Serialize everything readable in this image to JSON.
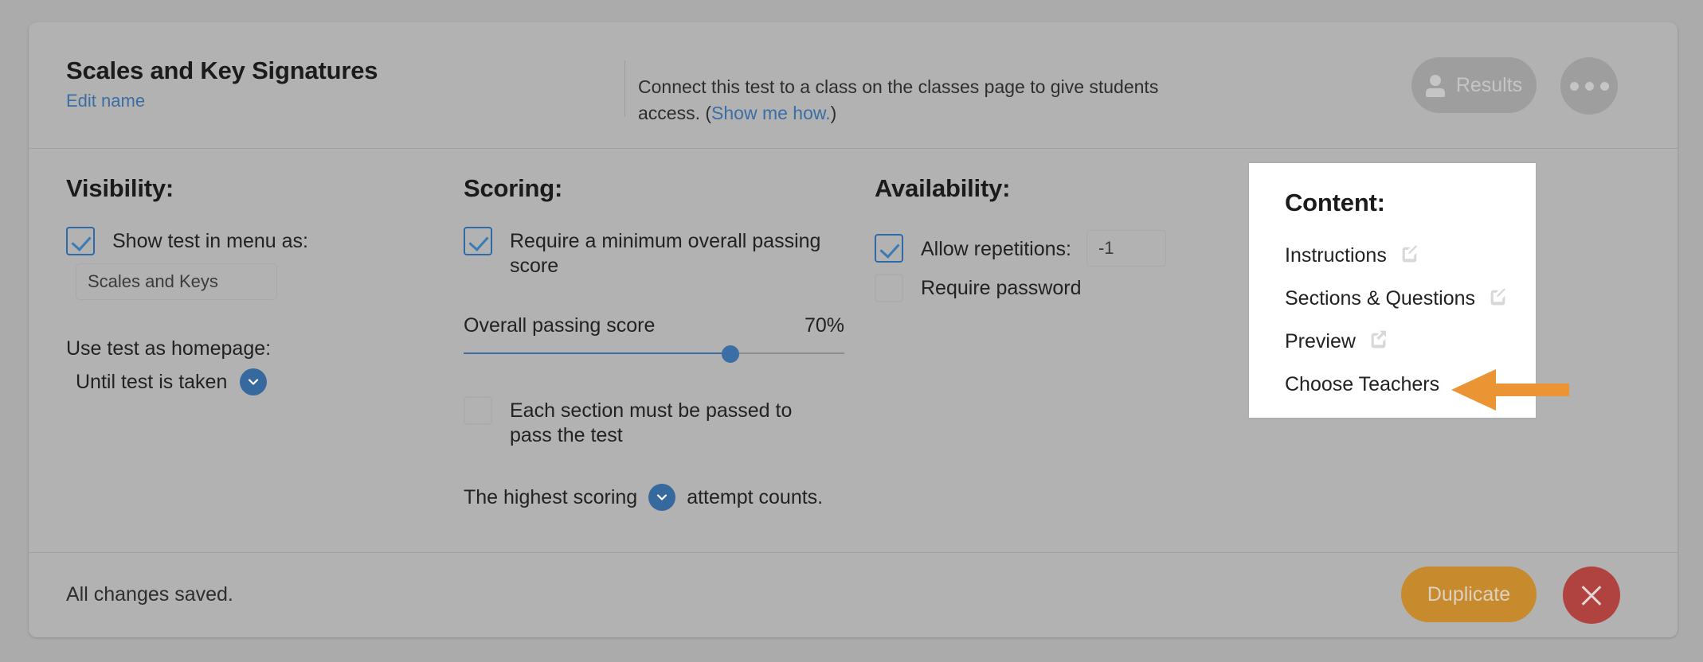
{
  "header": {
    "test_title": "Scales and Key Signatures",
    "edit_name_label": "Edit name",
    "connect_text_before": "Connect this test to a class on the classes page to give students access. (",
    "connect_link_label": "Show me how.",
    "connect_text_after": ")",
    "results_button_label": "Results",
    "results_icon": "person-icon",
    "more_icon": "ellipsis-icon"
  },
  "visibility": {
    "heading": "Visibility:",
    "show_in_menu_label": "Show test in menu as:",
    "show_in_menu_checked": true,
    "menu_name_value": "Scales and Keys",
    "homepage_label": "Use test as homepage:",
    "homepage_value": "Until test is taken",
    "homepage_dropdown_icon": "chevron-down-icon"
  },
  "scoring": {
    "heading": "Scoring:",
    "require_minimum_label": "Require a minimum overall passing score",
    "require_minimum_checked": true,
    "slider_label": "Overall passing score",
    "slider_value_label": "70%",
    "slider_value": 70,
    "each_section_label": "Each section must be passed to pass the test",
    "each_section_checked": false,
    "attempt_prefix": "The highest scoring",
    "attempt_suffix": "attempt counts.",
    "attempt_dropdown_icon": "chevron-down-icon"
  },
  "availability": {
    "heading": "Availability:",
    "allow_repetitions_label": "Allow repetitions:",
    "allow_repetitions_checked": true,
    "repetitions_value": "-1",
    "require_password_label": "Require password",
    "require_password_checked": false
  },
  "content_popup": {
    "heading": "Content:",
    "items": [
      {
        "label": "Instructions",
        "icon": "edit-icon"
      },
      {
        "label": "Sections & Questions",
        "icon": "edit-icon"
      },
      {
        "label": "Preview",
        "icon": "external-link-icon"
      },
      {
        "label": "Choose Teachers",
        "icon": "none"
      }
    ]
  },
  "footer": {
    "status_text": "All changes saved.",
    "duplicate_label": "Duplicate",
    "close_icon": "close-icon"
  },
  "colors": {
    "page_background": "#ababab",
    "card_background": "#b2b2b2",
    "accent_blue": "#3a6ea5",
    "dropdown_blue": "#36699e",
    "duplicate_orange": "#c78a2c",
    "close_red": "#b0433f",
    "callout_orange": "#eb9433",
    "popup_white": "#ffffff"
  }
}
